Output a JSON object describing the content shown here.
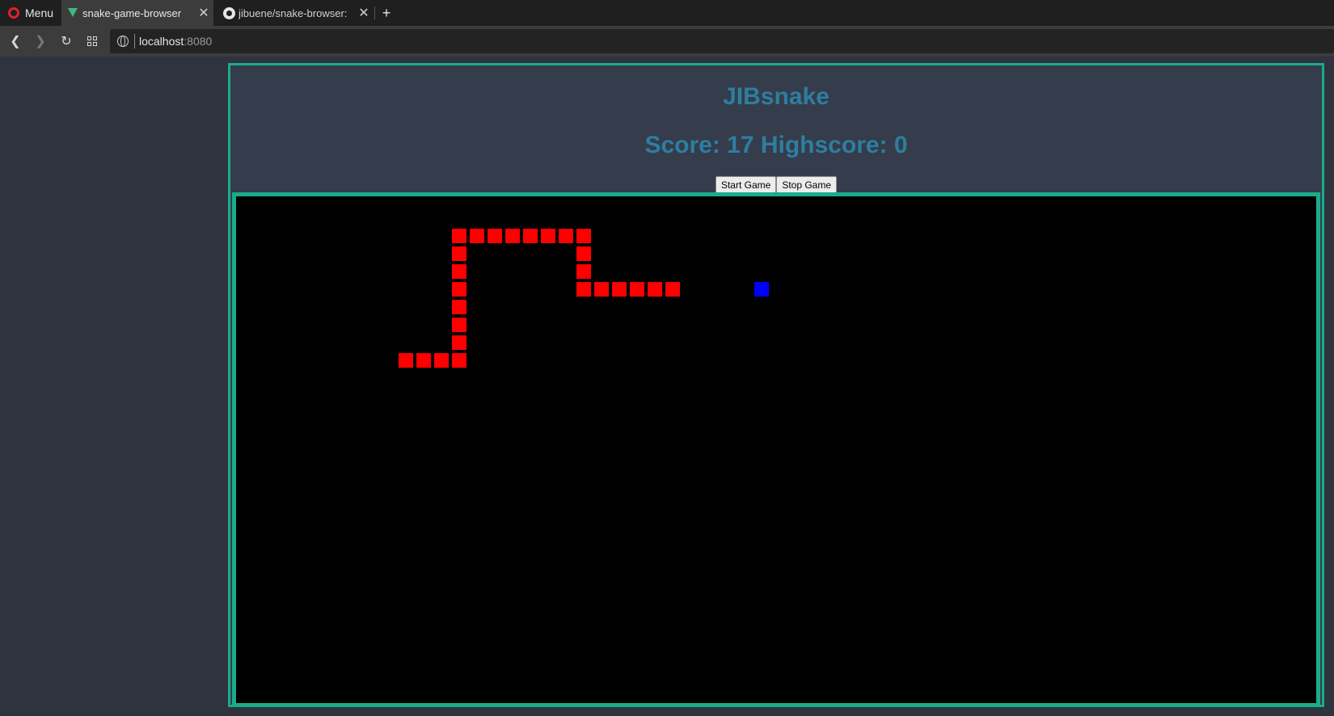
{
  "browser": {
    "menu_label": "Menu",
    "tabs": [
      {
        "title": "snake-game-browser",
        "active": true,
        "icon": "vue-icon"
      },
      {
        "title": "jibuene/snake-browser: ",
        "active": false,
        "icon": "github-icon"
      }
    ],
    "new_tab_label": "+",
    "close_label": "✕",
    "url_host": "localhost",
    "url_port": ":8080"
  },
  "game": {
    "title": "JIBsnake",
    "score_line": "Score: 17 Highscore: 0",
    "score": 17,
    "highscore": 0,
    "buttons": {
      "start": "Start Game",
      "stop": "Stop Game"
    },
    "colors": {
      "snake": "#ff0000",
      "food": "#0000ff",
      "board": "#000000",
      "border": "#1aab8a",
      "text": "#2d7ea1"
    },
    "grid_cell": 22,
    "snake": [
      [
        24,
        12
      ],
      [
        23,
        12
      ],
      [
        22,
        12
      ],
      [
        21,
        12
      ],
      [
        20,
        12
      ],
      [
        19,
        12
      ],
      [
        19,
        11
      ],
      [
        19,
        10
      ],
      [
        19,
        9
      ],
      [
        18,
        9
      ],
      [
        17,
        9
      ],
      [
        16,
        9
      ],
      [
        15,
        9
      ],
      [
        14,
        9
      ],
      [
        13,
        9
      ],
      [
        12,
        9
      ],
      [
        12,
        10
      ],
      [
        12,
        11
      ],
      [
        12,
        12
      ],
      [
        12,
        13
      ],
      [
        12,
        14
      ],
      [
        12,
        15
      ],
      [
        12,
        16
      ],
      [
        11,
        16
      ],
      [
        10,
        16
      ],
      [
        9,
        16
      ]
    ],
    "food": [
      29,
      12
    ]
  }
}
